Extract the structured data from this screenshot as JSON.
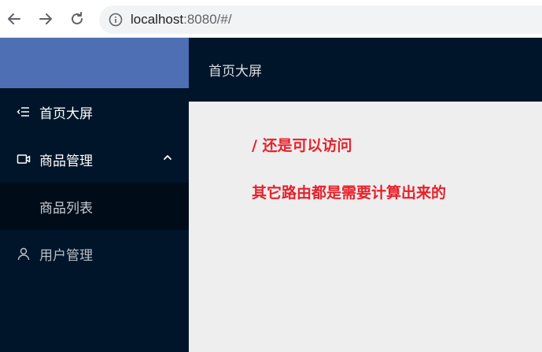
{
  "browser": {
    "url_host": "localhost",
    "url_rest": ":8080/#/"
  },
  "sidebar": {
    "items": [
      {
        "label": "首页大屏",
        "icon": "menu-fold-icon"
      },
      {
        "label": "商品管理",
        "icon": "video-camera-icon",
        "expanded": true,
        "children": [
          {
            "label": "商品列表"
          }
        ]
      },
      {
        "label": "用户管理",
        "icon": "user-icon"
      }
    ]
  },
  "header": {
    "title": "首页大屏"
  },
  "content": {
    "line1": "/ 还是可以访问",
    "line2": "其它路由都是需要计算出来的"
  },
  "colors": {
    "sidebar_bg": "#001529",
    "logo_bg": "#4e6fb4",
    "annotation_red": "#e8202a"
  }
}
